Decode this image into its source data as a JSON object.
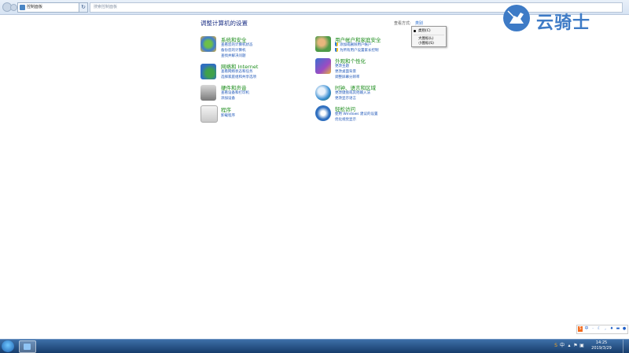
{
  "address_bar": {
    "breadcrumb": "控制面板",
    "search_placeholder": "搜索控制面板"
  },
  "main": {
    "title": "调整计算机的设置",
    "view_by_label": "查看方式:",
    "view_by_value": "类别",
    "view_menu": [
      "类别(C)",
      "大图标(L)",
      "小图标(S)"
    ]
  },
  "categories": [
    {
      "title": "系统和安全",
      "links": [
        "查看您的计算机状态",
        "备份您的计算机",
        "查找并解决问题"
      ]
    },
    {
      "title": "网络和 Internet",
      "links": [
        "查看网络状态和任务",
        "选择家庭组和共享选项"
      ]
    },
    {
      "title": "硬件和声音",
      "links": [
        "查看设备和打印机",
        "添加设备"
      ]
    },
    {
      "title": "程序",
      "links": [
        "卸载程序"
      ]
    },
    {
      "title": "用户帐户和家庭安全",
      "links": [
        "添加或删除用户帐户",
        "为所有用户设置家长控制"
      ]
    },
    {
      "title": "外观和个性化",
      "links": [
        "更改主题",
        "更改桌面背景",
        "调整屏幕分辨率"
      ]
    },
    {
      "title": "时钟、语言和区域",
      "links": [
        "更改键盘或其他输入法",
        "更改显示语言"
      ]
    },
    {
      "title": "轻松访问",
      "links": [
        "使用 Windows 建议的设置",
        "优化视觉显示"
      ]
    }
  ],
  "logo": {
    "text": "云骑士"
  },
  "taskbar": {
    "time": "14:25",
    "date": "2019/3/29"
  },
  "colors": {
    "accent": "#1e56b8",
    "category_title": "#1b8c1b",
    "taskbar": "#1f4a80",
    "logo": "#3e7bc6"
  }
}
